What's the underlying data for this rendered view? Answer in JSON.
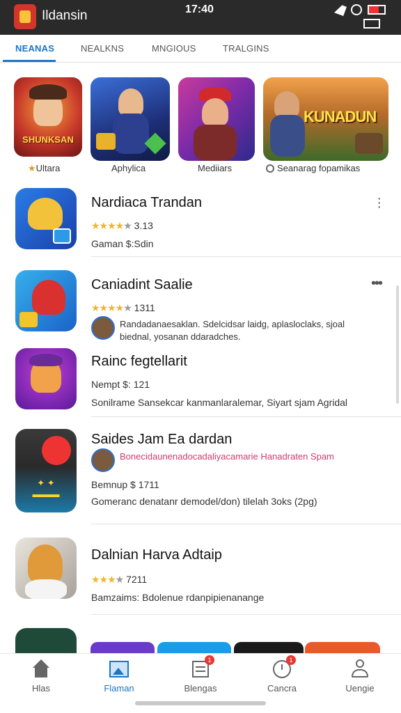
{
  "status_bar": {
    "app_name": "Ildansin",
    "time": "17:40"
  },
  "tabs": [
    {
      "label": "NEANAS",
      "active": true
    },
    {
      "label": "NEALKNS",
      "active": false
    },
    {
      "label": "MNGIOUS",
      "active": false
    },
    {
      "label": "TRALGINS",
      "active": false
    }
  ],
  "carousel": [
    {
      "label": "Ultara",
      "art_text": "SHUNKSAN"
    },
    {
      "label": "Aphylica",
      "art_text": ""
    },
    {
      "label": "Mediiars",
      "art_text": ""
    },
    {
      "label": "Seanarag fopamikas",
      "art_text": "KUNADUN"
    }
  ],
  "list": [
    {
      "title": "Nardiaca Trandan",
      "stars": "★★★★",
      "rating": "3.13",
      "meta": "Gaman $:Sdin",
      "has_menu": true
    },
    {
      "title": "Caniadint Saalie",
      "stars": "★★★★",
      "rating": "1311",
      "review": "Randadanaesaklan. Sdelcidsar laidg, aplasloclaks, sjoal",
      "review2": "biednal, yosanan ddaradches."
    },
    {
      "title": "Rainc fegtellarit",
      "meta": "Nempt $: 121",
      "desc": "Sonilrame Sansekcar kanmanlaralemar, Siyart sjam Agridal"
    },
    {
      "title": "Saides Jam Ea dardan",
      "review": "Bonecidaunenadocadaliyacamarie Hanadraten Spam",
      "meta": "Bemnup $ 1711",
      "desc": "Gomeranc denatanr demodel/don) tilelah 3oks (2pg)"
    },
    {
      "title": "Dalnian Harva Adtaip",
      "stars": "★★★",
      "rating": "7211",
      "meta": "Bamzaims: Bdolenue rdanpipienanange"
    }
  ],
  "bottom_nav": [
    {
      "label": "Hlas",
      "icon": "home-icon",
      "active": false,
      "badge": ""
    },
    {
      "label": "Flaman",
      "icon": "image-icon",
      "active": true,
      "badge": ""
    },
    {
      "label": "Blengas",
      "icon": "list-icon",
      "active": false,
      "badge": "1"
    },
    {
      "label": "Cancra",
      "icon": "clock-icon",
      "active": false,
      "badge": "1"
    },
    {
      "label": "Uengie",
      "icon": "user-icon",
      "active": false,
      "badge": ""
    }
  ],
  "colors": {
    "accent": "#1976c8",
    "star": "#f1b52a",
    "statusbar": "#2a2a2a"
  }
}
